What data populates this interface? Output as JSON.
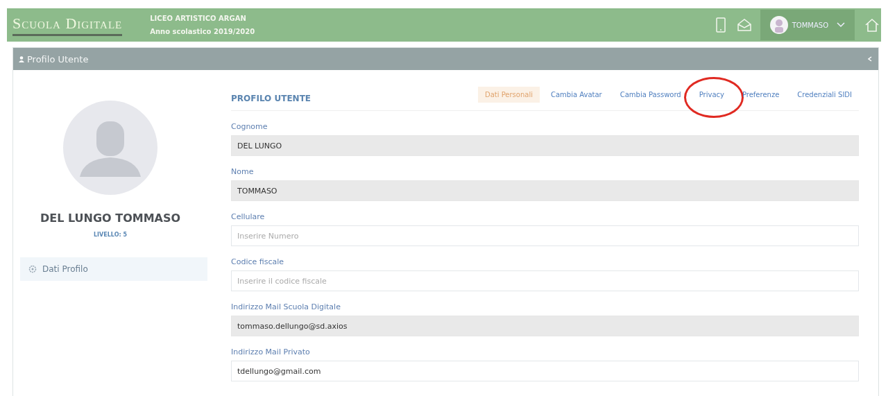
{
  "header": {
    "logo": "Scuola Digitale",
    "school": "LICEO ARTISTICO ARGAN",
    "year": "Anno scolastico 2019/2020",
    "user": "TOMMASO"
  },
  "panel": {
    "title": "Profilo Utente"
  },
  "profile": {
    "name": "DEL LUNGO TOMMASO",
    "level": "LIVELLO: 5",
    "menu": [
      {
        "label": "Dati Profilo",
        "selected": true
      }
    ]
  },
  "section_title": "PROFILO UTENTE",
  "tabs": [
    {
      "label": "Dati Personali",
      "selected": true,
      "circled": false
    },
    {
      "label": "Cambia Avatar",
      "selected": false,
      "circled": false
    },
    {
      "label": "Cambia Password",
      "selected": false,
      "circled": false
    },
    {
      "label": "Privacy",
      "selected": false,
      "circled": true
    },
    {
      "label": "Preferenze",
      "selected": false,
      "circled": false
    },
    {
      "label": "Credenziali SIDI",
      "selected": false,
      "circled": false
    }
  ],
  "fields": [
    {
      "label": "Cognome",
      "value": "DEL LUNGO",
      "disabled": true
    },
    {
      "label": "Nome",
      "value": "TOMMASO",
      "disabled": true
    },
    {
      "label": "Cellulare",
      "placeholder": "Inserire Numero",
      "disabled": false
    },
    {
      "label": "Codice fiscale",
      "placeholder": "Inserire il codice fiscale",
      "disabled": false
    },
    {
      "label": "Indirizzo Mail Scuola Digitale",
      "value": "tommaso.dellungo@sd.axios",
      "disabled": true
    },
    {
      "label": "Indirizzo Mail Privato",
      "value": "tdellungo@gmail.com",
      "disabled": false
    }
  ]
}
